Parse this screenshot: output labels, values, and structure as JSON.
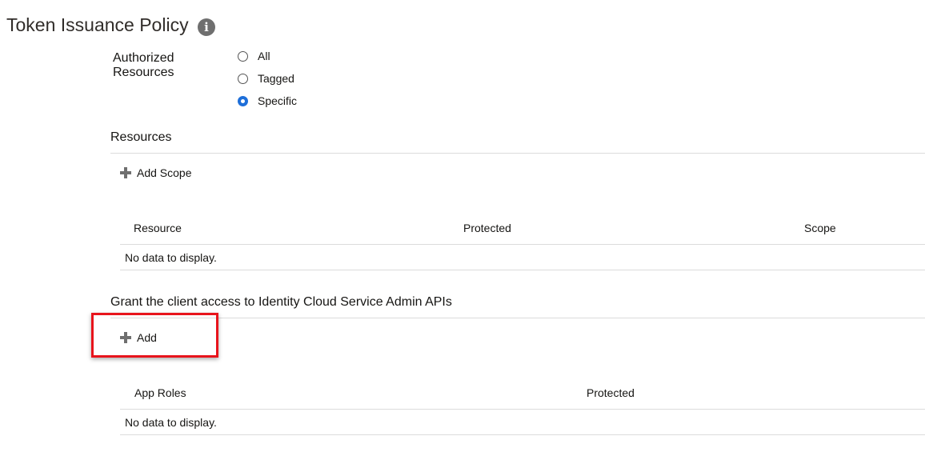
{
  "page": {
    "title": "Token Issuance Policy",
    "info_icon": "info-icon"
  },
  "authorized_resources": {
    "label": "Authorized Resources",
    "options": [
      {
        "label": "All",
        "checked": false
      },
      {
        "label": "Tagged",
        "checked": false
      },
      {
        "label": "Specific",
        "checked": true
      }
    ]
  },
  "resources": {
    "heading": "Resources",
    "add_scope_label": "Add Scope",
    "add_icon": "plus-icon",
    "columns": [
      "Resource",
      "Protected",
      "Scope"
    ],
    "empty_message": "No data to display."
  },
  "admin_apis": {
    "heading": "Grant the client access to Identity Cloud Service Admin APIs",
    "add_label": "Add",
    "add_icon": "plus-icon",
    "columns": [
      "App Roles",
      "Protected"
    ],
    "empty_message": "No data to display."
  },
  "annotation": {
    "highlight_color": "#e8141c"
  }
}
